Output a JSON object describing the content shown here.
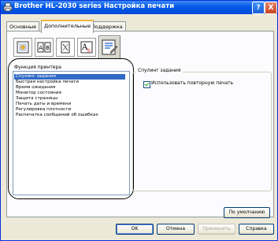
{
  "window": {
    "title": "Brother HL-2030 series Настройка печати"
  },
  "title_buttons": {
    "help": "?",
    "close": "X"
  },
  "tabs": [
    {
      "label": "Основные"
    },
    {
      "label": "Дополнительные"
    },
    {
      "label": "Поддержка"
    }
  ],
  "toolbar_icons": [
    "watermark-icon",
    "page-layout-icon",
    "duplex-print-icon",
    "font-substitution-icon",
    "device-options-icon"
  ],
  "functions": {
    "label": "Функция принтера",
    "items": [
      "Спулинг задания",
      "Быстрая настройка печати",
      "Время ожидания",
      "Монитор состояния",
      "Защита страницы",
      "Печать даты и времени",
      "Регулировка плотности",
      "Распечатка сообщений об ошибках"
    ],
    "selected_index": 0
  },
  "group": {
    "label": "Спулинг задания",
    "checkbox_label": "Использовать повторную печать",
    "checkbox_checked": true
  },
  "buttons": {
    "default_settings": "По умолчанию",
    "ok": "OK",
    "cancel": "Отмена",
    "apply": "Применить",
    "help": "Справка"
  }
}
